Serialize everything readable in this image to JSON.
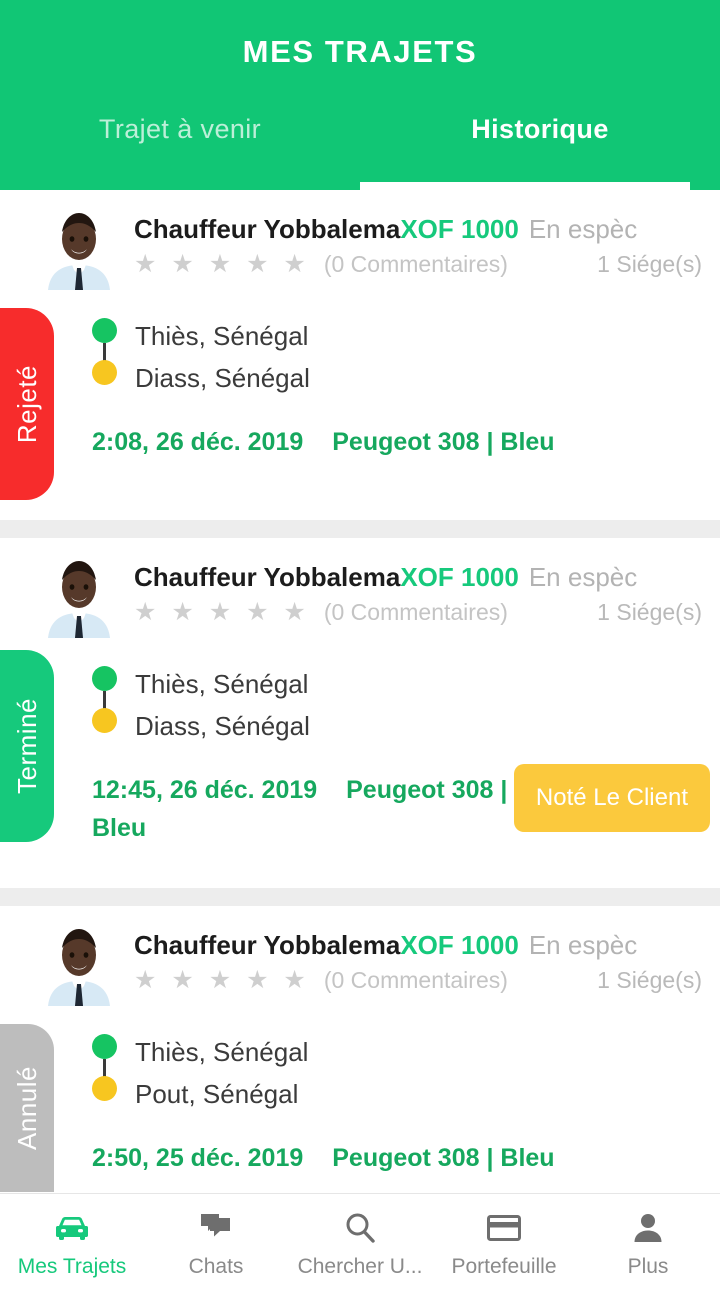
{
  "header": {
    "title": "MES TRAJETS",
    "tabs": [
      {
        "label": "Trajet à venir",
        "active": false
      },
      {
        "label": "Historique",
        "active": true
      }
    ]
  },
  "colors": {
    "brand_green": "#11c675",
    "accent_green": "#16c97c",
    "rejected_red": "#f72c2c",
    "cancelled_gray": "#bdbdbd",
    "rate_button_yellow": "#fbc93d",
    "origin_dot": "#16c462",
    "destination_dot": "#f7c620"
  },
  "trips": [
    {
      "status": "Rejeté",
      "driver_name": "Chauffeur Yobbalema",
      "price": "XOF 1000",
      "payment_method": "En espèc",
      "stars": "★ ★ ★ ★ ★",
      "rating_count": "(0 Commentaires)",
      "seats": "1 Siége(s)",
      "origin": "Thiès, Sénégal",
      "destination": "Diass, Sénégal",
      "datetime": "2:08, 26 déc. 2019",
      "vehicle": "Peugeot 308 | Bleu",
      "action_label": null
    },
    {
      "status": "Terminé",
      "driver_name": "Chauffeur Yobbalema",
      "price": "XOF 1000",
      "payment_method": "En espèc",
      "stars": "★ ★ ★ ★ ★",
      "rating_count": "(0 Commentaires)",
      "seats": "1 Siége(s)",
      "origin": "Thiès, Sénégal",
      "destination": "Diass, Sénégal",
      "datetime": "12:45, 26 déc. 2019",
      "vehicle": "Peugeot 308 | Bleu",
      "action_label": "Noté Le Client"
    },
    {
      "status": "Annulé",
      "driver_name": "Chauffeur Yobbalema",
      "price": "XOF 1000",
      "payment_method": "En espèc",
      "stars": "★ ★ ★ ★ ★",
      "rating_count": "(0 Commentaires)",
      "seats": "1 Siége(s)",
      "origin": "Thiès, Sénégal",
      "destination": "Pout, Sénégal",
      "datetime": "2:50, 25 déc. 2019",
      "vehicle": "Peugeot 308 | Bleu",
      "action_label": null
    }
  ],
  "bottom_nav": [
    {
      "label": "Mes Trajets",
      "icon": "car-icon",
      "active": true
    },
    {
      "label": "Chats",
      "icon": "chat-icon",
      "active": false
    },
    {
      "label": "Chercher U...",
      "icon": "search-icon",
      "active": false
    },
    {
      "label": "Portefeuille",
      "icon": "wallet-icon",
      "active": false
    },
    {
      "label": "Plus",
      "icon": "person-icon",
      "active": false
    }
  ]
}
